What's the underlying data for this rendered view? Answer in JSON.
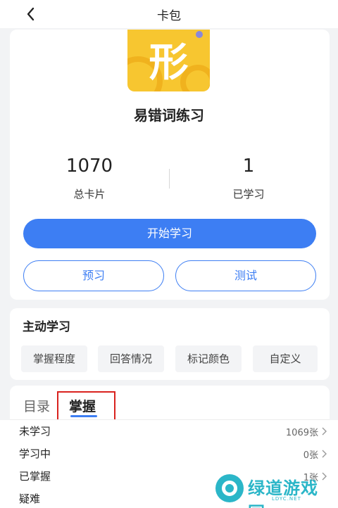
{
  "header": {
    "title": "卡包"
  },
  "deck": {
    "logo_char": "形",
    "name": "易错词练习"
  },
  "stats": {
    "total_value": "1070",
    "total_label": "总卡片",
    "learned_value": "1",
    "learned_label": "已学习"
  },
  "actions": {
    "start": "开始学习",
    "preview": "预习",
    "test": "测试"
  },
  "active_learning": {
    "title": "主动学习",
    "chips": [
      "掌握程度",
      "回答情况",
      "标记颜色",
      "自定义"
    ]
  },
  "tabs": {
    "catalog": "目录",
    "mastery": "掌握"
  },
  "list": [
    {
      "name": "未学习",
      "count": "1069张"
    },
    {
      "name": "学习中",
      "count": "0张"
    },
    {
      "name": "已掌握",
      "count": "1张"
    },
    {
      "name": "疑难",
      "count": ""
    }
  ],
  "watermark": {
    "text": "绿道游戏园",
    "sub": "LDYC.NET"
  },
  "colors": {
    "accent": "#3d7ef3",
    "logo_bg": "#f7c630",
    "highlight": "#d9221e",
    "watermark": "#2bb6c8"
  },
  "icons": {
    "back": "chevron-left-icon",
    "row": "chevron-right-icon"
  }
}
